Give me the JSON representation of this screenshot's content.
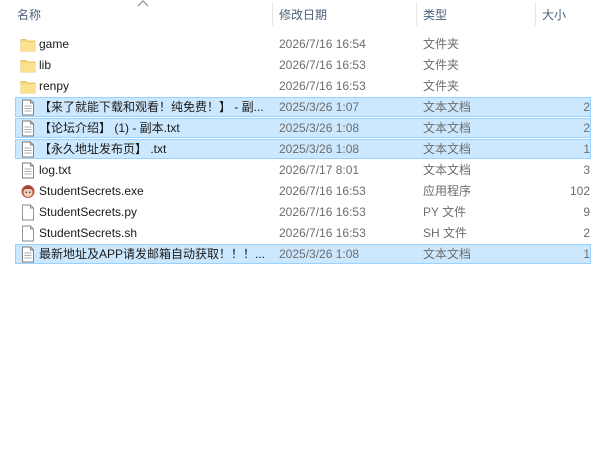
{
  "columns": {
    "name": "名称",
    "modified": "修改日期",
    "type": "类型",
    "size": "大小"
  },
  "files": [
    {
      "name": "game",
      "modified": "2026/7/16 16:54",
      "type": "文件夹",
      "size": "",
      "icon": "folder-icon",
      "selected": false
    },
    {
      "name": "lib",
      "modified": "2026/7/16 16:53",
      "type": "文件夹",
      "size": "",
      "icon": "folder-icon",
      "selected": false
    },
    {
      "name": "renpy",
      "modified": "2026/7/16 16:53",
      "type": "文件夹",
      "size": "",
      "icon": "folder-icon",
      "selected": false
    },
    {
      "name": "【来了就能下载和观看！纯免费！】 - 副...",
      "modified": "2025/3/26 1:07",
      "type": "文本文档",
      "size": "2",
      "icon": "text-file-icon",
      "selected": true
    },
    {
      "name": "【论坛介绍】 (1) - 副本.txt",
      "modified": "2025/3/26 1:08",
      "type": "文本文档",
      "size": "2",
      "icon": "text-file-icon",
      "selected": true
    },
    {
      "name": "【永久地址发布页】 .txt",
      "modified": "2025/3/26 1:08",
      "type": "文本文档",
      "size": "1",
      "icon": "text-file-icon",
      "selected": true
    },
    {
      "name": "log.txt",
      "modified": "2026/7/17 8:01",
      "type": "文本文档",
      "size": "3",
      "icon": "text-file-icon",
      "selected": false
    },
    {
      "name": "StudentSecrets.exe",
      "modified": "2026/7/16 16:53",
      "type": "应用程序",
      "size": "102",
      "icon": "app-exe-icon",
      "selected": false
    },
    {
      "name": "StudentSecrets.py",
      "modified": "2026/7/16 16:53",
      "type": "PY 文件",
      "size": "9",
      "icon": "file-icon",
      "selected": false
    },
    {
      "name": "StudentSecrets.sh",
      "modified": "2026/7/16 16:53",
      "type": "SH 文件",
      "size": "2",
      "icon": "file-icon",
      "selected": false
    },
    {
      "name": "最新地址及APP请发邮箱自动获取！！！...",
      "modified": "2025/3/26 1:08",
      "type": "文本文档",
      "size": "1",
      "icon": "text-file-icon",
      "selected": true
    }
  ],
  "colors": {
    "selection_bg": "#cce8ff",
    "selection_border": "#99d1ff",
    "folder": "#f8d775",
    "header_text": "#4c607a"
  }
}
